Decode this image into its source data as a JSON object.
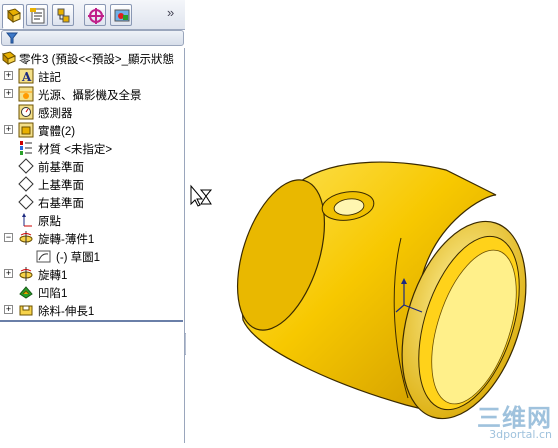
{
  "feature_tree": {
    "root": "零件3  (預設<<預設>_顯示狀態",
    "items": [
      {
        "label": "註記",
        "expandable": true,
        "icon": "annotation-icon"
      },
      {
        "label": "光源、攝影機及全景",
        "expandable": true,
        "icon": "lights-icon"
      },
      {
        "label": "感測器",
        "expandable": false,
        "icon": "sensor-icon"
      },
      {
        "label": "實體(2)",
        "expandable": true,
        "icon": "solid-bodies-icon"
      },
      {
        "label": "材質 <未指定>",
        "expandable": false,
        "icon": "material-icon"
      },
      {
        "label": "前基準面",
        "expandable": false,
        "icon": "plane-icon"
      },
      {
        "label": "上基準面",
        "expandable": false,
        "icon": "plane-icon"
      },
      {
        "label": "右基準面",
        "expandable": false,
        "icon": "plane-icon"
      },
      {
        "label": "原點",
        "expandable": false,
        "icon": "origin-icon"
      },
      {
        "label": "旋轉-薄件1",
        "expandable": true,
        "expanded": true,
        "icon": "revolve-icon"
      },
      {
        "label": "(-) 草圖1",
        "expandable": false,
        "child": true,
        "icon": "sketch-icon"
      },
      {
        "label": "旋轉1",
        "expandable": true,
        "icon": "revolve-icon"
      },
      {
        "label": "凹陷1",
        "expandable": false,
        "icon": "indent-icon"
      },
      {
        "label": "除料-伸長1",
        "expandable": true,
        "icon": "cut-extrude-icon"
      }
    ]
  },
  "tabs": [
    {
      "name": "featuremanager-tab",
      "icon": "feature-tree-icon"
    },
    {
      "name": "propertymanager-tab",
      "icon": "property-icon"
    },
    {
      "name": "configurationmanager-tab",
      "icon": "configuration-icon"
    },
    {
      "name": "dimxpert-tab",
      "icon": "dimxpert-icon"
    },
    {
      "name": "display-manager-tab",
      "icon": "display-icon"
    }
  ],
  "more_glyph": "»",
  "watermark": {
    "big": "三维网",
    "small": "3dportal.cn"
  },
  "colors": {
    "part_yellow": "#f5c800",
    "part_shadow": "#b88a00",
    "tree_line": "#6a7fa8"
  }
}
